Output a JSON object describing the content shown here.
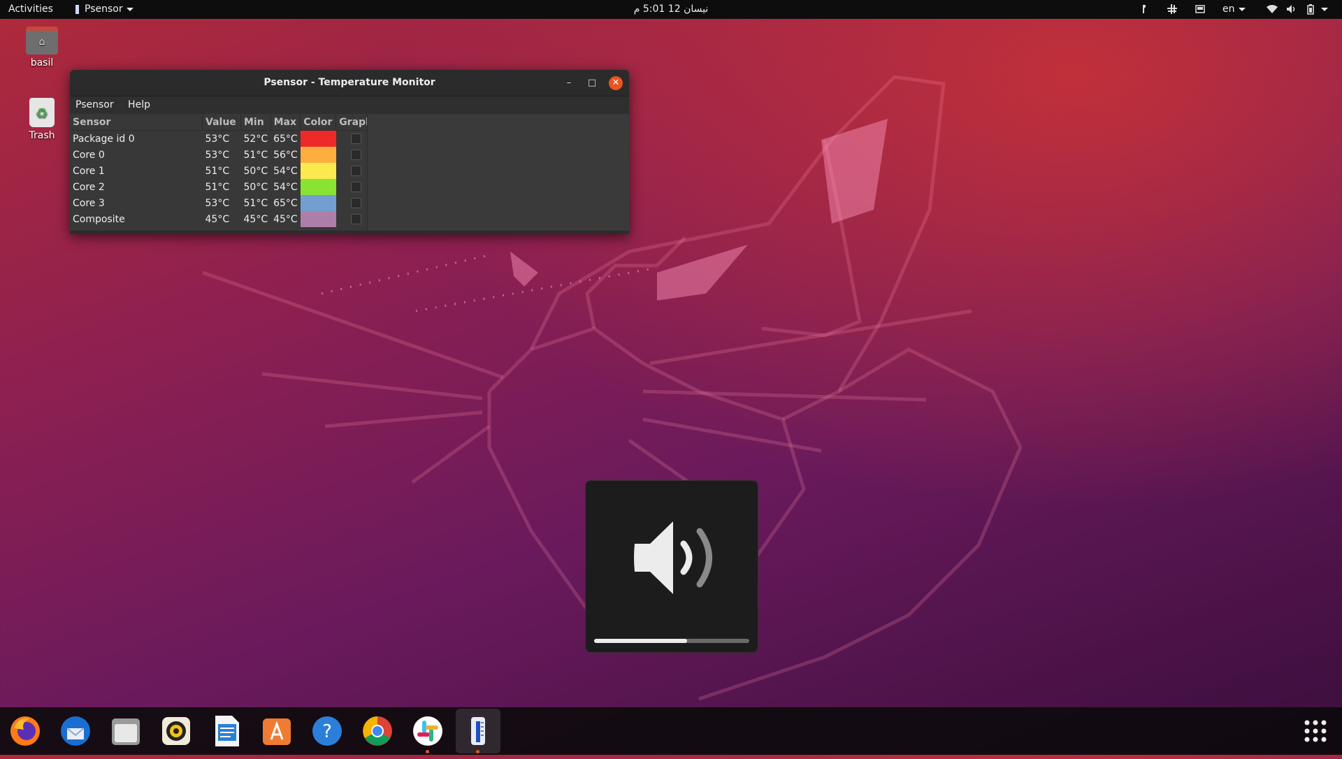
{
  "topbar": {
    "activities": "Activities",
    "app_menu": "Psensor",
    "clock": "نيسان 12  5:01 م",
    "language": "en"
  },
  "desktop": {
    "home_label": "basil",
    "trash_label": "Trash"
  },
  "window": {
    "title": "Psensor - Temperature Monitor",
    "menu": [
      "Psensor",
      "Help"
    ],
    "columns": [
      "Sensor",
      "Value",
      "Min",
      "Max",
      "Color",
      "Graph"
    ],
    "rows": [
      {
        "sensor": "Package id 0",
        "value": "53°C",
        "min": "52°C",
        "max": "65°C",
        "color": "#ef2929"
      },
      {
        "sensor": "Core 0",
        "value": "53°C",
        "min": "51°C",
        "max": "56°C",
        "color": "#fcaf3e"
      },
      {
        "sensor": "Core 1",
        "value": "51°C",
        "min": "50°C",
        "max": "54°C",
        "color": "#fce94f"
      },
      {
        "sensor": "Core 2",
        "value": "51°C",
        "min": "50°C",
        "max": "54°C",
        "color": "#8ae234"
      },
      {
        "sensor": "Core 3",
        "value": "53°C",
        "min": "51°C",
        "max": "65°C",
        "color": "#729fcf"
      },
      {
        "sensor": "Composite",
        "value": "45°C",
        "min": "45°C",
        "max": "45°C",
        "color": "#ad7fa8"
      }
    ]
  },
  "osd": {
    "icon": "speaker-volume-icon",
    "level": 0.6
  },
  "dock": {
    "apps": [
      "firefox",
      "thunderbird",
      "files",
      "rhythmbox",
      "libreoffice-writer",
      "software-center",
      "help",
      "chrome",
      "slack",
      "psensor"
    ]
  },
  "colors": {
    "accent": "#e95420"
  }
}
